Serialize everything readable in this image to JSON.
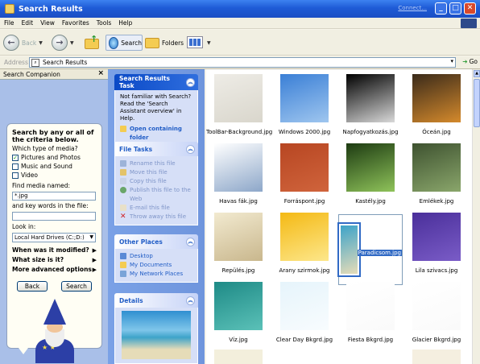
{
  "window": {
    "title": "Search Results",
    "connection_link": "Connect..."
  },
  "menu": [
    "File",
    "Edit",
    "View",
    "Favorites",
    "Tools",
    "Help"
  ],
  "toolbar": {
    "back_label": "Back",
    "search_label": "Search",
    "folders_label": "Folders"
  },
  "address": {
    "label": "Address",
    "value": "Search Results",
    "go_label": "Go"
  },
  "companion": {
    "title": "Search Companion",
    "criteria_heading": "Search by any or all of the criteria below.",
    "media_type_label": "Which type of media?",
    "options": [
      {
        "label": "Pictures and Photos",
        "checked": true
      },
      {
        "label": "Music and Sound",
        "checked": false
      },
      {
        "label": "Video",
        "checked": false
      }
    ],
    "media_name_label": "Find media named:",
    "media_name_value": "*.jpg",
    "keywords_label": "and key words in the file:",
    "keywords_value": "",
    "lookin_label": "Look in:",
    "lookin_value": "Local Hard Drives (C:;D:)",
    "questions": [
      "When was it modified?",
      "What size is it?",
      "More advanced options"
    ],
    "back_button": "Back",
    "search_button": "Search"
  },
  "tasks": {
    "results": {
      "title": "Search Results Task",
      "help_text": "Not familiar with Search? Read the 'Search Assistant overview' in Help.",
      "open_folder": "Open containing folder"
    },
    "file_tasks": {
      "title": "File Tasks",
      "items": [
        "Rename this file",
        "Move this file",
        "Copy this file",
        "Publish this file to the Web",
        "E-mail this file",
        "Throw away this file"
      ]
    },
    "other_places": {
      "title": "Other Places",
      "items": [
        "Desktop",
        "My Documents",
        "My Network Places"
      ]
    },
    "details": {
      "title": "Details"
    }
  },
  "files": [
    {
      "name": "ToolBar-Background.jpg",
      "colors": [
        "#eeece6",
        "#d9d6cc"
      ]
    },
    {
      "name": "Windows 2000.jpg",
      "colors": [
        "#3a7fd6",
        "#9fc6ef"
      ]
    },
    {
      "name": "Napfogyatkozás.jpg",
      "colors": [
        "#000000",
        "#d9d9d9"
      ]
    },
    {
      "name": "Óceán.jpg",
      "colors": [
        "#3a2a1a",
        "#d58a2c"
      ]
    },
    {
      "name": "Havas fák.jpg",
      "colors": [
        "#ffffff",
        "#8da7c9"
      ]
    },
    {
      "name": "Forráspont.jpg",
      "colors": [
        "#b74622",
        "#d0643c"
      ]
    },
    {
      "name": "Kastély.jpg",
      "colors": [
        "#1d3b12",
        "#8fc35a"
      ]
    },
    {
      "name": "Emlékek.jpg",
      "colors": [
        "#3e5230",
        "#8aa66b"
      ]
    },
    {
      "name": "Repülés.jpg",
      "colors": [
        "#f2ead0",
        "#c9b78d"
      ]
    },
    {
      "name": "Arany szirmok.jpg",
      "colors": [
        "#f4b914",
        "#fde78b"
      ]
    },
    {
      "name": "Paradicsom.jpg",
      "colors": [
        "#3da3c9",
        "#e6dcb8"
      ],
      "selected": true
    },
    {
      "name": "Lila szivacs.jpg",
      "colors": [
        "#4a2f9a",
        "#7a5cc7"
      ]
    },
    {
      "name": "Víz.jpg",
      "colors": [
        "#1e8a86",
        "#5bc1b8"
      ]
    },
    {
      "name": "Clear Day Bkgrd.jpg",
      "colors": [
        "#e6f4fb",
        "#f8fcfe"
      ]
    },
    {
      "name": "Fiesta Bkgrd.jpg",
      "colors": [
        "#ffffff",
        "#fafafa"
      ]
    },
    {
      "name": "Glacier Bkgrd.jpg",
      "colors": [
        "#ffffff",
        "#fafafa"
      ]
    }
  ]
}
